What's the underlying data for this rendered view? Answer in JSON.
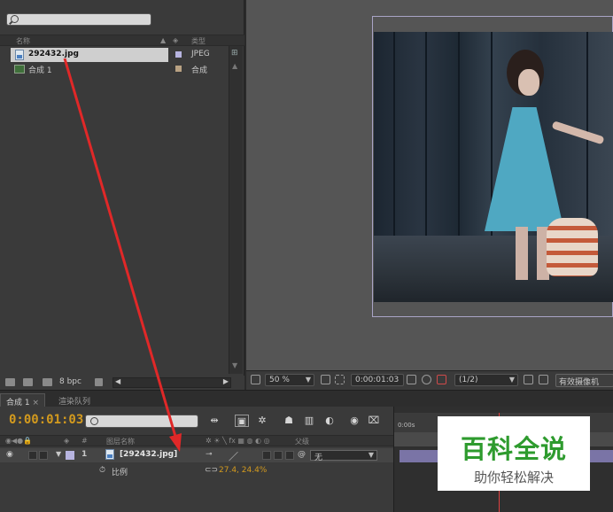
{
  "project_panel": {
    "columns": {
      "name": "名称",
      "type": "类型"
    },
    "items": [
      {
        "name": "292432.jpg",
        "type": "JPEG",
        "swatch_color": "#b7b4e0"
      },
      {
        "name": "合成 1",
        "type": "合成",
        "swatch_color": "#b9a283"
      }
    ],
    "bpc_label": "8 bpc"
  },
  "viewer_toolbar": {
    "zoom": "50 %",
    "timecode": "0:00:01:03",
    "resolution": "(1/2)",
    "camera": "有效摄像机"
  },
  "timeline_tabs": [
    "合成 1",
    "渲染队列"
  ],
  "timeline": {
    "current_time": "0:00:01:03",
    "columns": {
      "source_name": "图层名称",
      "parent": "父级",
      "hash": "#"
    },
    "layer": {
      "index": "1",
      "name": "[292432.jpg]",
      "parent": "无",
      "label_color": "#b7b4e0"
    },
    "property": {
      "name": "比例",
      "value": "27.4, 24.4%"
    },
    "ruler_start": "0:00s"
  },
  "watermark": {
    "title": "百科全说",
    "subtitle": "助你轻松解决"
  },
  "colors": {
    "accent_orange": "#d39a1e",
    "annotation_red": "#e02828",
    "layer_bar": "#7a74a6",
    "watermark_green": "#2e9b2e"
  }
}
